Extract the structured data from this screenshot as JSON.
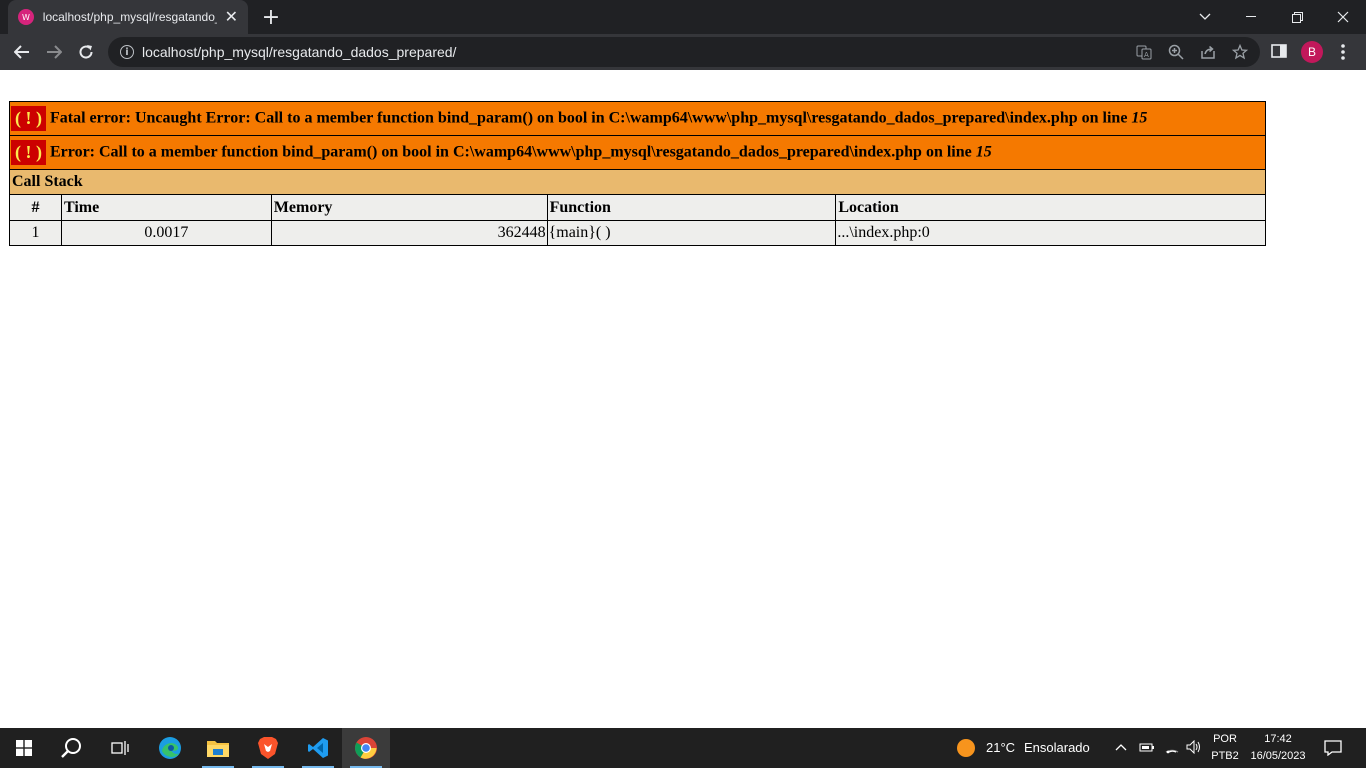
{
  "browser": {
    "tab_title": "localhost/php_mysql/resgatando_dados_prepared/",
    "favicon_text": "W",
    "tab_close": "✕",
    "new_tab": "+",
    "url": "localhost/php_mysql/resgatando_dados_prepared/",
    "profile_initial": "B"
  },
  "error": {
    "bang": "( ! )",
    "fatal_text": "Fatal error: Uncaught Error: Call to a member function bind_param() on bool in C:\\wamp64\\www\\php_mysql\\resgatando_dados_prepared\\index.php on line ",
    "fatal_line": "15",
    "error_text": "Error: Call to a member function bind_param() on bool in C:\\wamp64\\www\\php_mysql\\resgatando_dados_prepared\\index.php on line ",
    "error_line": "15",
    "call_stack_title": "Call Stack",
    "columns": [
      "#",
      "Time",
      "Memory",
      "Function",
      "Location"
    ],
    "rows": [
      {
        "num": "1",
        "time": "0.0017",
        "memory": "362448",
        "function": "{main}( )",
        "location": "...\\index.php:0"
      }
    ]
  },
  "taskbar": {
    "weather_temp": "21°C",
    "weather_desc": "Ensolarado",
    "lang_top": "POR",
    "lang_bottom": "PTB2",
    "time": "17:42",
    "date": "16/05/2023"
  },
  "colors": {
    "error_orange": "#f57900",
    "bang_red": "#cc0000",
    "bang_yellow": "#fce94f",
    "callstack_tan": "#e9b96e",
    "row_gray": "#eeeeec"
  }
}
